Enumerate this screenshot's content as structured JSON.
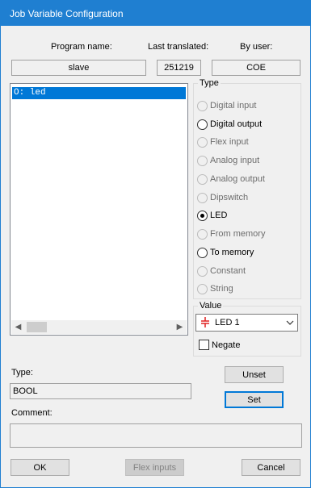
{
  "window": {
    "title": "Job Variable Configuration"
  },
  "header": {
    "program_name_label": "Program name:",
    "program_name_value": "slave",
    "last_translated_label": "Last translated:",
    "last_translated_value": "251219",
    "by_user_label": "By user:",
    "by_user_value": "COE"
  },
  "variables_list": {
    "items": [
      {
        "label": "O: led",
        "selected": true
      }
    ]
  },
  "type_group": {
    "title": "Type",
    "options": [
      {
        "label": "Digital input",
        "enabled": false,
        "checked": false
      },
      {
        "label": "Digital output",
        "enabled": true,
        "checked": false
      },
      {
        "label": "Flex input",
        "enabled": false,
        "checked": false
      },
      {
        "label": "Analog input",
        "enabled": false,
        "checked": false
      },
      {
        "label": "Analog output",
        "enabled": false,
        "checked": false
      },
      {
        "label": "Dipswitch",
        "enabled": false,
        "checked": false
      },
      {
        "label": "LED",
        "enabled": true,
        "checked": true
      },
      {
        "label": "From memory",
        "enabled": false,
        "checked": false
      },
      {
        "label": "To memory",
        "enabled": true,
        "checked": false
      },
      {
        "label": "Constant",
        "enabled": false,
        "checked": false
      },
      {
        "label": "String",
        "enabled": false,
        "checked": false
      }
    ]
  },
  "value_group": {
    "title": "Value",
    "selected": "LED 1",
    "icon": "led-icon",
    "negate_label": "Negate",
    "negate_checked": false
  },
  "type_field": {
    "label": "Type:",
    "value": "BOOL"
  },
  "comment_field": {
    "label": "Comment:",
    "value": ""
  },
  "buttons": {
    "unset": "Unset",
    "set": "Set",
    "ok": "OK",
    "flex_inputs": "Flex inputs",
    "cancel": "Cancel"
  },
  "colors": {
    "title_bar": "#1f7fd1",
    "selection": "#0078d7",
    "led_icon": "#e02020"
  }
}
